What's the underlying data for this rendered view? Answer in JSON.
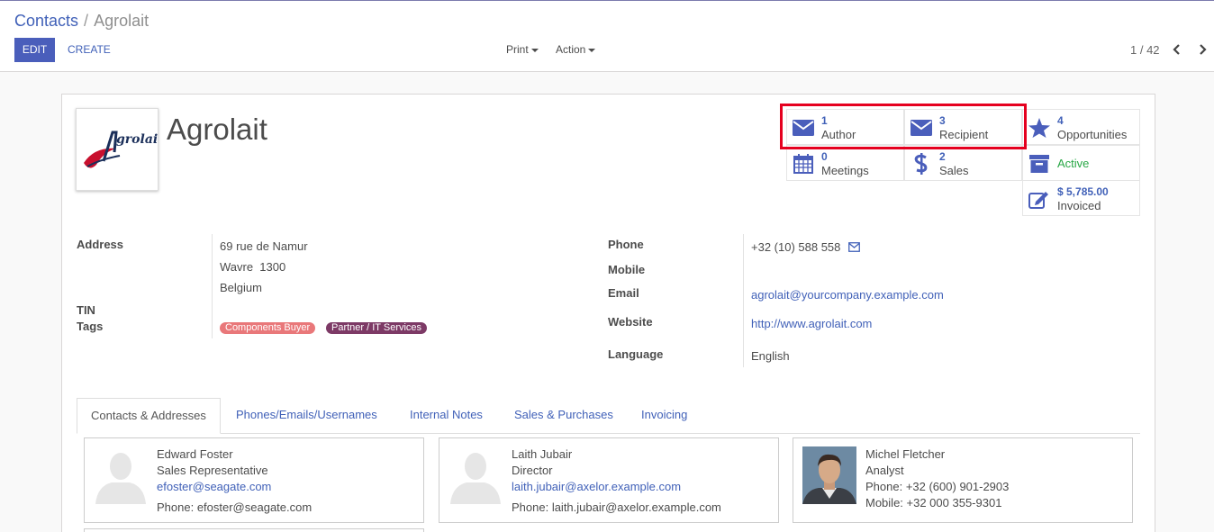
{
  "breadcrumb": {
    "parent": "Contacts",
    "separator": "/",
    "current": "Agrolait"
  },
  "toolbar": {
    "edit_label": "EDIT",
    "create_label": "CREATE",
    "print_label": "Print",
    "action_label": "Action"
  },
  "pager": {
    "text": "1 / 42"
  },
  "record": {
    "name": "Agrolait",
    "logo_text": "Agrolait"
  },
  "smart_buttons": {
    "author": {
      "count": "1",
      "label": "Author",
      "icon": "envelope-icon"
    },
    "recipient": {
      "count": "3",
      "label": "Recipient",
      "icon": "envelope-icon"
    },
    "opportunities": {
      "count": "4",
      "label": "Opportunities",
      "icon": "star-icon"
    },
    "meetings": {
      "count": "0",
      "label": "Meetings",
      "icon": "calendar-icon"
    },
    "sales": {
      "count": "2",
      "label": "Sales",
      "icon": "dollar-icon"
    },
    "active": {
      "label": "Active",
      "icon": "archive-icon"
    },
    "invoiced": {
      "amount": "$ 5,785.00",
      "label": "Invoiced",
      "icon": "pencil-square-icon"
    }
  },
  "fields": {
    "address_label": "Address",
    "street": "69 rue de Namur",
    "city_zip": "Wavre  1300",
    "country": "Belgium",
    "tin_label": "TIN",
    "tags_label": "Tags",
    "tags": [
      {
        "label": "Components Buyer",
        "color": "#e9787a"
      },
      {
        "label": "Partner / IT Services",
        "color": "#7d3a66"
      }
    ],
    "phone_label": "Phone",
    "phone": "+32 (10) 588 558",
    "mobile_label": "Mobile",
    "email_label": "Email",
    "email": "agrolait@yourcompany.example.com",
    "website_label": "Website",
    "website": "http://www.agrolait.com",
    "language_label": "Language",
    "language": "English"
  },
  "tabs": [
    {
      "label": "Contacts & Addresses",
      "active": true
    },
    {
      "label": "Phones/Emails/Usernames"
    },
    {
      "label": "Internal Notes"
    },
    {
      "label": "Sales & Purchases"
    },
    {
      "label": "Invoicing"
    }
  ],
  "contacts": [
    {
      "name": "Edward Foster",
      "role": "Sales Representative",
      "email": "efoster@seagate.com",
      "phone": "Phone: efoster@seagate.com"
    },
    {
      "name": "Laith Jubair",
      "role": "Director",
      "email": "laith.jubair@axelor.example.com",
      "phone": "Phone: laith.jubair@axelor.example.com"
    },
    {
      "name": "Michel Fletcher",
      "role": "Analyst",
      "phone": "Phone: +32 (600) 901-2903",
      "mobile": "Mobile: +32 000 355-9301"
    }
  ],
  "colors": {
    "accent": "#4a5ebb",
    "link": "#4161b8",
    "highlight": "#e5001f",
    "active": "#28a745"
  }
}
